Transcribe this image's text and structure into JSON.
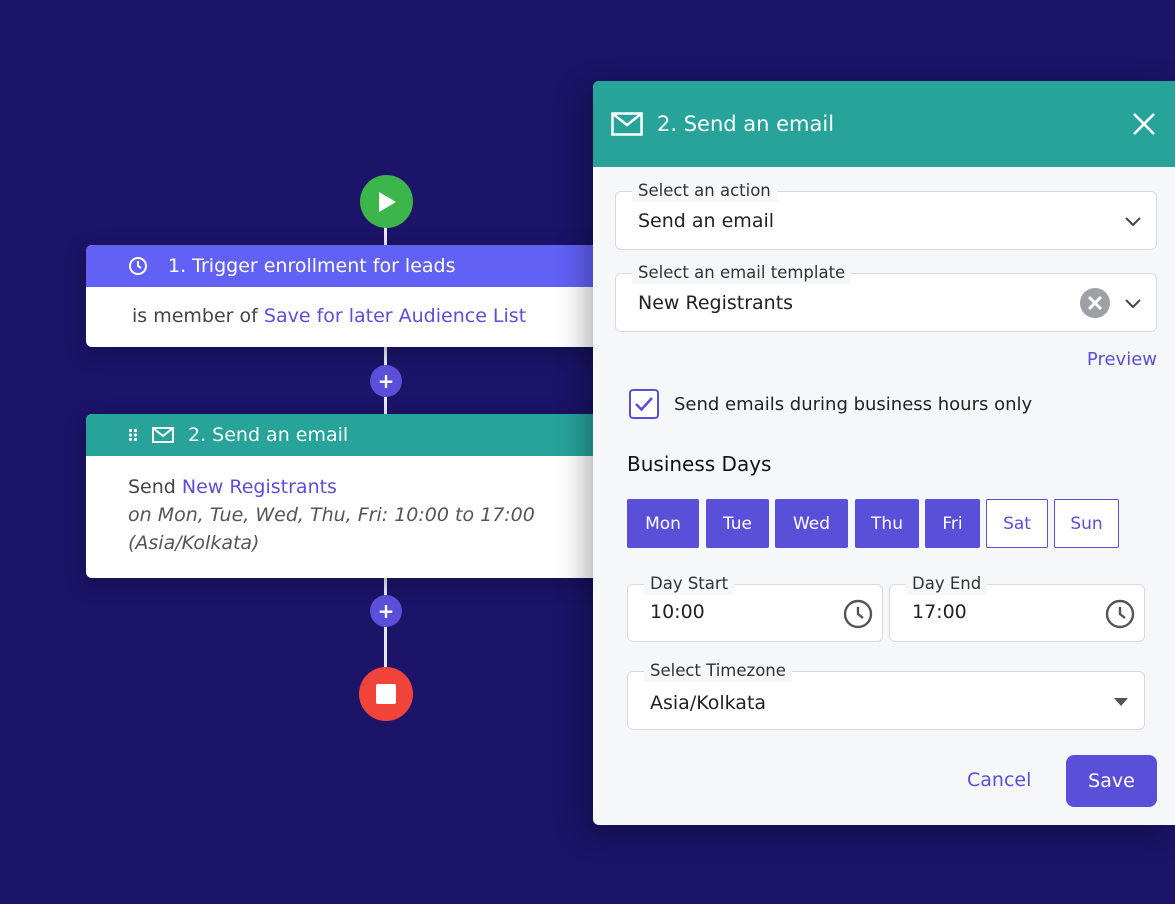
{
  "flow": {
    "trigger": {
      "title": "1. Trigger enrollment for leads",
      "condition_prefix": "is member of",
      "condition_link": "Save for later Audience List"
    },
    "email_step": {
      "title": "2. Send an email",
      "send_prefix": "Send",
      "template_link": "New Registrants",
      "schedule_line1": "on Mon, Tue, Wed, Thu, Fri: 10:00 to 17:00",
      "schedule_line2": "(Asia/Kolkata)"
    },
    "plus_label": "+"
  },
  "panel": {
    "title": "2. Send an email",
    "action": {
      "label": "Select an action",
      "value": "Send an email"
    },
    "template": {
      "label": "Select an email template",
      "value": "New Registrants"
    },
    "preview_link": "Preview",
    "business_hours_checkbox": {
      "label": "Send emails during business hours only",
      "checked": true
    },
    "business_days_heading": "Business Days",
    "days": [
      {
        "label": "Mon",
        "selected": true
      },
      {
        "label": "Tue",
        "selected": true
      },
      {
        "label": "Wed",
        "selected": true
      },
      {
        "label": "Thu",
        "selected": true
      },
      {
        "label": "Fri",
        "selected": true
      },
      {
        "label": "Sat",
        "selected": false
      },
      {
        "label": "Sun",
        "selected": false
      }
    ],
    "day_start": {
      "label": "Day Start",
      "value": "10:00"
    },
    "day_end": {
      "label": "Day End",
      "value": "17:00"
    },
    "timezone": {
      "label": "Select Timezone",
      "value": "Asia/Kolkata"
    },
    "cancel_label": "Cancel",
    "save_label": "Save"
  },
  "colors": {
    "background": "#1b1468",
    "accent": "#5a4fd9",
    "teal": "#27a39a",
    "start": "#3cb54a",
    "stop": "#f0443a"
  }
}
